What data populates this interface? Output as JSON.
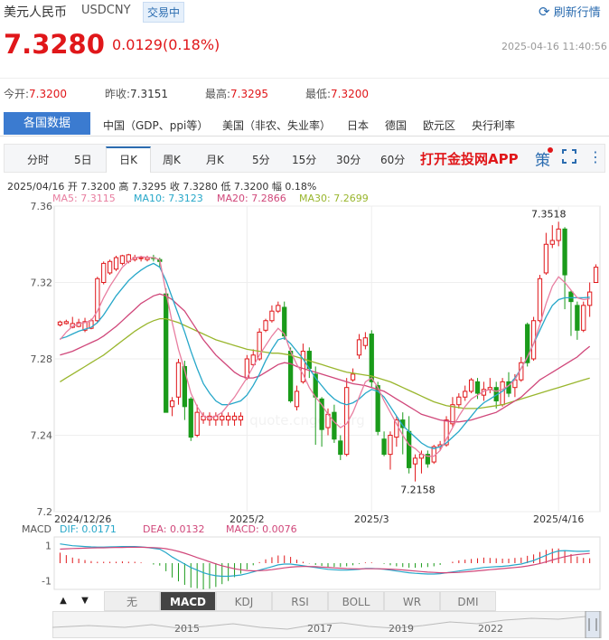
{
  "header": {
    "name": "美元人民币",
    "code": "USDCNY",
    "badge": "交易中",
    "refresh": "刷新行情"
  },
  "quote": {
    "price": "7.3280",
    "change": "0.0129(0.18%)",
    "datetime": "2025-04-16 11:40:56"
  },
  "stats": [
    {
      "label": "今开:",
      "value": "7.3200"
    },
    {
      "label": "昨收:",
      "value": "7.3151"
    },
    {
      "label": "最高:",
      "value": "7.3295"
    },
    {
      "label": "最低:",
      "value": "7.3200"
    }
  ],
  "nav": {
    "active": "各国数据",
    "items": [
      "中国（GDP、ppi等）",
      "美国（非农、失业率）",
      "日本",
      "德国",
      "欧元区",
      "央行利率"
    ]
  },
  "tabs": {
    "items": [
      "分时",
      "5日",
      "日K",
      "周K",
      "月K",
      "5分",
      "15分",
      "30分",
      "60分"
    ],
    "active": "日K",
    "app_link": "打开金投网APP",
    "ce": "策"
  },
  "info_line": {
    "date": "2025/04/16",
    "open": "开 7.3200",
    "high": "高 7.3295",
    "close": "收 7.3280",
    "low": "低 7.3200",
    "amp": "幅 0.18%"
  },
  "ma_legend": [
    {
      "label": "MA5: 7.3115",
      "color": "#e87ea0"
    },
    {
      "label": "MA10: 7.3123",
      "color": "#26a7c9"
    },
    {
      "label": "MA20: 7.2866",
      "color": "#d0477a"
    },
    {
      "label": "MA30: 7.2699",
      "color": "#99b62d"
    }
  ],
  "macd_legend": {
    "title": "MACD",
    "dif": "DIF: 0.0171",
    "dea": "DEA: 0.0132",
    "macd": "MACD: 0.0076"
  },
  "bottom_tabs": {
    "items": [
      "无",
      "MACD",
      "KDJ",
      "RSI",
      "BOLL",
      "WR",
      "DMI"
    ],
    "active": "MACD",
    "up": "▲",
    "down": "▼"
  },
  "navigator_years": [
    "2015",
    "2017",
    "2019",
    "2022"
  ],
  "colors": {
    "up": "#e0171a",
    "down": "#1a9b1a",
    "accent": "#2b6cb0"
  },
  "chart_data": {
    "type": "candlestick",
    "ylim": [
      7.2,
      7.36
    ],
    "y_ticks": [
      "7.36",
      "7.32",
      "7.28",
      "7.24",
      "7.2"
    ],
    "x_ticks": [
      {
        "label": "2024/12/26",
        "index": 0
      },
      {
        "label": "2025/2",
        "index": 30
      },
      {
        "label": "2025/3",
        "index": 50
      },
      {
        "label": "2025/4/16",
        "index": 80
      }
    ],
    "annotations": [
      {
        "text": "7.3518",
        "index": 79,
        "value": 7.3518
      },
      {
        "text": "7.2158",
        "index": 58,
        "value": 7.2158
      }
    ],
    "candles": [
      [
        7.2978,
        7.2993,
        7.3,
        7.297
      ],
      [
        7.2985,
        7.2995,
        7.3005,
        7.298
      ],
      [
        7.2965,
        7.2985,
        7.302,
        7.296
      ],
      [
        7.297,
        7.299,
        7.301,
        7.2965
      ],
      [
        7.295,
        7.2995,
        7.3015,
        7.294
      ],
      [
        7.296,
        7.3,
        7.301,
        7.2955
      ],
      [
        7.3,
        7.322,
        7.323,
        7.299
      ],
      [
        7.32,
        7.33,
        7.331,
        7.319
      ],
      [
        7.325,
        7.331,
        7.332,
        7.324
      ],
      [
        7.327,
        7.333,
        7.334,
        7.326
      ],
      [
        7.33,
        7.334,
        7.3345,
        7.329
      ],
      [
        7.331,
        7.3345,
        7.335,
        7.33
      ],
      [
        7.332,
        7.333,
        7.3345,
        7.331
      ],
      [
        7.3325,
        7.333,
        7.334,
        7.331
      ],
      [
        7.332,
        7.333,
        7.334,
        7.331
      ],
      [
        7.333,
        7.3325,
        7.3345,
        7.331
      ],
      [
        7.332,
        7.331,
        7.333,
        7.328
      ],
      [
        7.314,
        7.252,
        7.317,
        7.252
      ],
      [
        7.255,
        7.258,
        7.26,
        7.25
      ],
      [
        7.26,
        7.278,
        7.28,
        7.256
      ],
      [
        7.276,
        7.255,
        7.279,
        7.248
      ],
      [
        7.259,
        7.239,
        7.26,
        7.237
      ],
      [
        7.24,
        7.252,
        7.256,
        7.239
      ],
      [
        7.248,
        7.25,
        7.252,
        7.246
      ],
      [
        7.248,
        7.25,
        7.252,
        7.245
      ],
      [
        7.248,
        7.25,
        7.252,
        7.245
      ],
      [
        7.248,
        7.25,
        7.252,
        7.245
      ],
      [
        7.248,
        7.25,
        7.252,
        7.245
      ],
      [
        7.248,
        7.25,
        7.252,
        7.245
      ],
      [
        7.248,
        7.25,
        7.252,
        7.245
      ],
      [
        7.27,
        7.28,
        7.282,
        7.269
      ],
      [
        7.277,
        7.282,
        7.285,
        7.276
      ],
      [
        7.28,
        7.294,
        7.296,
        7.279
      ],
      [
        7.295,
        7.3,
        7.301,
        7.294
      ],
      [
        7.3,
        7.305,
        7.308,
        7.299
      ],
      [
        7.305,
        7.308,
        7.31,
        7.304
      ],
      [
        7.307,
        7.292,
        7.31,
        7.29
      ],
      [
        7.284,
        7.258,
        7.286,
        7.257
      ],
      [
        7.255,
        7.263,
        7.266,
        7.253
      ],
      [
        7.268,
        7.284,
        7.288,
        7.267
      ],
      [
        7.284,
        7.275,
        7.286,
        7.27
      ],
      [
        7.272,
        7.26,
        7.276,
        7.235
      ],
      [
        7.259,
        7.243,
        7.26,
        7.234
      ],
      [
        7.244,
        7.251,
        7.254,
        7.24
      ],
      [
        7.252,
        7.238,
        7.256,
        7.236
      ],
      [
        7.237,
        7.23,
        7.24,
        7.227
      ],
      [
        7.23,
        7.265,
        7.27,
        7.229
      ],
      [
        7.269,
        7.272,
        7.275,
        7.268
      ],
      [
        7.282,
        7.29,
        7.293,
        7.28
      ],
      [
        7.287,
        7.291,
        7.294,
        7.285
      ],
      [
        7.293,
        7.268,
        7.295,
        7.265
      ],
      [
        7.266,
        7.242,
        7.268,
        7.24
      ],
      [
        7.238,
        7.23,
        7.242,
        7.229
      ],
      [
        7.23,
        7.24,
        7.242,
        7.222
      ],
      [
        7.239,
        7.248,
        7.25,
        7.234
      ],
      [
        7.248,
        7.244,
        7.252,
        7.23
      ],
      [
        7.242,
        7.223,
        7.25,
        7.22
      ],
      [
        7.225,
        7.228,
        7.23,
        7.2158
      ],
      [
        7.228,
        7.23,
        7.232,
        7.22
      ],
      [
        7.23,
        7.225,
        7.232,
        7.223
      ],
      [
        7.226,
        7.234,
        7.235,
        7.225
      ],
      [
        7.234,
        7.235,
        7.237,
        7.232
      ],
      [
        7.235,
        7.248,
        7.25,
        7.234
      ],
      [
        7.246,
        7.256,
        7.26,
        7.244
      ],
      [
        7.256,
        7.26,
        7.262,
        7.254
      ],
      [
        7.26,
        7.263,
        7.266,
        7.258
      ],
      [
        7.263,
        7.269,
        7.27,
        7.262
      ],
      [
        7.268,
        7.262,
        7.27,
        7.259
      ],
      [
        7.261,
        7.264,
        7.268,
        7.258
      ],
      [
        7.264,
        7.265,
        7.27,
        7.262
      ],
      [
        7.265,
        7.258,
        7.268,
        7.254
      ],
      [
        7.256,
        7.268,
        7.27,
        7.255
      ],
      [
        7.268,
        7.262,
        7.273,
        7.26
      ],
      [
        7.265,
        7.269,
        7.272,
        7.26
      ],
      [
        7.269,
        7.278,
        7.281,
        7.268
      ],
      [
        7.298,
        7.278,
        7.299,
        7.276
      ],
      [
        7.28,
        7.3,
        7.302,
        7.279
      ],
      [
        7.3,
        7.322,
        7.324,
        7.299
      ],
      [
        7.325,
        7.34,
        7.346,
        7.324
      ],
      [
        7.34,
        7.342,
        7.35,
        7.338
      ],
      [
        7.342,
        7.348,
        7.3518,
        7.339
      ],
      [
        7.348,
        7.324,
        7.349,
        7.306
      ],
      [
        7.315,
        7.31,
        7.316,
        7.292
      ],
      [
        7.308,
        7.295,
        7.31,
        7.29
      ],
      [
        7.295,
        7.308,
        7.31,
        7.294
      ],
      [
        7.308,
        7.315,
        7.32,
        7.302
      ],
      [
        7.32,
        7.328,
        7.3295,
        7.32
      ]
    ],
    "ma5": [
      7.29,
      7.294,
      7.297,
      7.2985,
      7.299,
      7.3,
      7.305,
      7.312,
      7.318,
      7.323,
      7.328,
      7.331,
      7.333,
      7.3335,
      7.3332,
      7.333,
      7.332,
      7.315,
      7.299,
      7.285,
      7.274,
      7.262,
      7.255,
      7.25,
      7.249,
      7.25,
      7.252,
      7.256,
      7.26,
      7.265,
      7.27,
      7.276,
      7.282,
      7.287,
      7.292,
      7.296,
      7.293,
      7.284,
      7.277,
      7.272,
      7.265,
      7.26,
      7.256,
      7.251,
      7.247,
      7.244,
      7.246,
      7.252,
      7.26,
      7.268,
      7.27,
      7.265,
      7.258,
      7.252,
      7.246,
      7.24,
      7.235,
      7.233,
      7.23,
      7.229,
      7.229,
      7.232,
      7.238,
      7.244,
      7.25,
      7.255,
      7.259,
      7.261,
      7.263,
      7.264,
      7.263,
      7.264,
      7.266,
      7.269,
      7.275,
      7.281,
      7.288,
      7.298,
      7.309,
      7.318,
      7.323,
      7.32,
      7.316,
      7.312,
      7.311,
      7.3115
    ],
    "ma10": [
      7.2905,
      7.2915,
      7.293,
      7.2945,
      7.2955,
      7.2965,
      7.299,
      7.303,
      7.308,
      7.313,
      7.317,
      7.321,
      7.324,
      7.3265,
      7.3285,
      7.33,
      7.328,
      7.321,
      7.312,
      7.303,
      7.294,
      7.284,
      7.275,
      7.267,
      7.262,
      7.258,
      7.256,
      7.256,
      7.257,
      7.258,
      7.261,
      7.266,
      7.272,
      7.279,
      7.285,
      7.29,
      7.291,
      7.288,
      7.284,
      7.28,
      7.275,
      7.27,
      7.266,
      7.262,
      7.259,
      7.257,
      7.256,
      7.257,
      7.259,
      7.262,
      7.264,
      7.263,
      7.26,
      7.255,
      7.25,
      7.245,
      7.242,
      7.239,
      7.236,
      7.234,
      7.233,
      7.234,
      7.236,
      7.239,
      7.242,
      7.246,
      7.25,
      7.254,
      7.257,
      7.259,
      7.261,
      7.263,
      7.266,
      7.27,
      7.275,
      7.281,
      7.288,
      7.295,
      7.302,
      7.308,
      7.311,
      7.312,
      7.312,
      7.312,
      7.312,
      7.3123
    ],
    "ma20": [
      7.282,
      7.283,
      7.284,
      7.2855,
      7.287,
      7.2885,
      7.29,
      7.292,
      7.2945,
      7.297,
      7.3,
      7.303,
      7.306,
      7.309,
      7.311,
      7.313,
      7.314,
      7.313,
      7.311,
      7.308,
      7.305,
      7.3,
      7.295,
      7.29,
      7.286,
      7.282,
      7.279,
      7.276,
      7.273,
      7.271,
      7.27,
      7.27,
      7.271,
      7.273,
      7.275,
      7.277,
      7.278,
      7.2775,
      7.276,
      7.275,
      7.274,
      7.273,
      7.272,
      7.271,
      7.27,
      7.269,
      7.268,
      7.267,
      7.2665,
      7.266,
      7.265,
      7.264,
      7.263,
      7.261,
      7.259,
      7.257,
      7.255,
      7.253,
      7.251,
      7.25,
      7.249,
      7.248,
      7.2475,
      7.247,
      7.247,
      7.2475,
      7.248,
      7.249,
      7.25,
      7.251,
      7.252,
      7.254,
      7.256,
      7.258,
      7.26,
      7.263,
      7.266,
      7.269,
      7.271,
      7.273,
      7.275,
      7.277,
      7.279,
      7.281,
      7.284,
      7.2866
    ],
    "ma30": [
      7.268,
      7.27,
      7.272,
      7.274,
      7.276,
      7.278,
      7.28,
      7.282,
      7.2845,
      7.287,
      7.2895,
      7.292,
      7.2945,
      7.2965,
      7.2985,
      7.3,
      7.301,
      7.301,
      7.3,
      7.299,
      7.2975,
      7.296,
      7.2945,
      7.293,
      7.2915,
      7.29,
      7.289,
      7.288,
      7.287,
      7.286,
      7.285,
      7.2845,
      7.284,
      7.2835,
      7.283,
      7.283,
      7.2825,
      7.282,
      7.281,
      7.28,
      7.279,
      7.278,
      7.277,
      7.276,
      7.275,
      7.274,
      7.273,
      7.2725,
      7.272,
      7.2715,
      7.271,
      7.27,
      7.269,
      7.268,
      7.2665,
      7.265,
      7.2635,
      7.262,
      7.2605,
      7.259,
      7.2575,
      7.2565,
      7.2555,
      7.255,
      7.2545,
      7.254,
      7.254,
      7.254,
      7.2545,
      7.255,
      7.2555,
      7.256,
      7.257,
      7.258,
      7.259,
      7.26,
      7.261,
      7.262,
      7.263,
      7.264,
      7.265,
      7.266,
      7.267,
      7.268,
      7.269,
      7.2699
    ],
    "macd": {
      "ylim": [
        -1.5,
        1.5
      ],
      "y_ticks": [
        "1",
        "-1"
      ],
      "dif": [
        1.1,
        1.05,
        1.0,
        0.98,
        0.95,
        0.93,
        0.92,
        0.92,
        0.93,
        0.94,
        0.95,
        0.95,
        0.95,
        0.93,
        0.9,
        0.85,
        0.8,
        0.6,
        0.35,
        0.15,
        -0.05,
        -0.25,
        -0.4,
        -0.55,
        -0.65,
        -0.72,
        -0.75,
        -0.75,
        -0.72,
        -0.68,
        -0.6,
        -0.5,
        -0.4,
        -0.3,
        -0.2,
        -0.1,
        -0.05,
        -0.05,
        -0.1,
        -0.15,
        -0.2,
        -0.25,
        -0.3,
        -0.35,
        -0.38,
        -0.4,
        -0.4,
        -0.38,
        -0.35,
        -0.3,
        -0.3,
        -0.32,
        -0.35,
        -0.4,
        -0.45,
        -0.5,
        -0.55,
        -0.58,
        -0.6,
        -0.62,
        -0.62,
        -0.6,
        -0.55,
        -0.5,
        -0.45,
        -0.4,
        -0.35,
        -0.3,
        -0.25,
        -0.22,
        -0.2,
        -0.18,
        -0.15,
        -0.1,
        -0.05,
        0.05,
        0.15,
        0.3,
        0.45,
        0.6,
        0.7,
        0.72,
        0.7,
        0.68,
        0.68,
        0.7
      ],
      "dea": [
        0.8,
        0.82,
        0.84,
        0.85,
        0.86,
        0.87,
        0.88,
        0.88,
        0.89,
        0.9,
        0.9,
        0.91,
        0.91,
        0.91,
        0.9,
        0.89,
        0.87,
        0.83,
        0.76,
        0.67,
        0.57,
        0.45,
        0.32,
        0.2,
        0.08,
        -0.04,
        -0.15,
        -0.24,
        -0.32,
        -0.38,
        -0.42,
        -0.44,
        -0.43,
        -0.41,
        -0.37,
        -0.32,
        -0.27,
        -0.23,
        -0.2,
        -0.19,
        -0.19,
        -0.2,
        -0.22,
        -0.24,
        -0.27,
        -0.29,
        -0.31,
        -0.32,
        -0.33,
        -0.32,
        -0.32,
        -0.32,
        -0.33,
        -0.34,
        -0.36,
        -0.39,
        -0.42,
        -0.45,
        -0.48,
        -0.51,
        -0.53,
        -0.55,
        -0.55,
        -0.54,
        -0.53,
        -0.5,
        -0.47,
        -0.44,
        -0.41,
        -0.37,
        -0.34,
        -0.31,
        -0.28,
        -0.25,
        -0.21,
        -0.16,
        -0.1,
        -0.02,
        0.07,
        0.18,
        0.28,
        0.37,
        0.44,
        0.49,
        0.53,
        0.56
      ]
    }
  }
}
